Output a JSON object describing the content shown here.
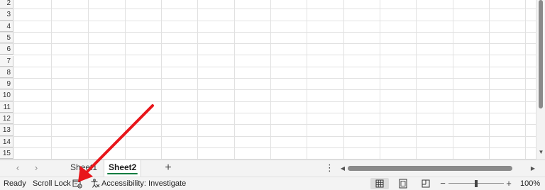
{
  "grid": {
    "rows": [
      "2",
      "3",
      "4",
      "5",
      "6",
      "7",
      "8",
      "9",
      "10",
      "11",
      "12",
      "13",
      "14",
      "15"
    ]
  },
  "tabs": {
    "prev_icon": "chevron-left-icon",
    "next_icon": "chevron-right-icon",
    "sheets": [
      {
        "label": "Sheet1",
        "active": false
      },
      {
        "label": "Sheet2",
        "active": true
      }
    ],
    "add_sheet_label": "+",
    "more_label": "⋮",
    "active_underline_color": "#107c41"
  },
  "status": {
    "ready": "Ready",
    "scroll_lock": "Scroll Lock",
    "macro_icon": "record-macro-icon",
    "accessibility_icon": "accessibility-icon",
    "accessibility": "Accessibility: Investigate",
    "views": [
      "normal-view-icon",
      "page-layout-view-icon",
      "page-break-preview-icon"
    ],
    "zoom_minus": "−",
    "zoom_plus": "+",
    "zoom_level": "100%",
    "zoom_fraction": 0.5
  },
  "annotation": {
    "arrow_color": "#e8161b"
  }
}
